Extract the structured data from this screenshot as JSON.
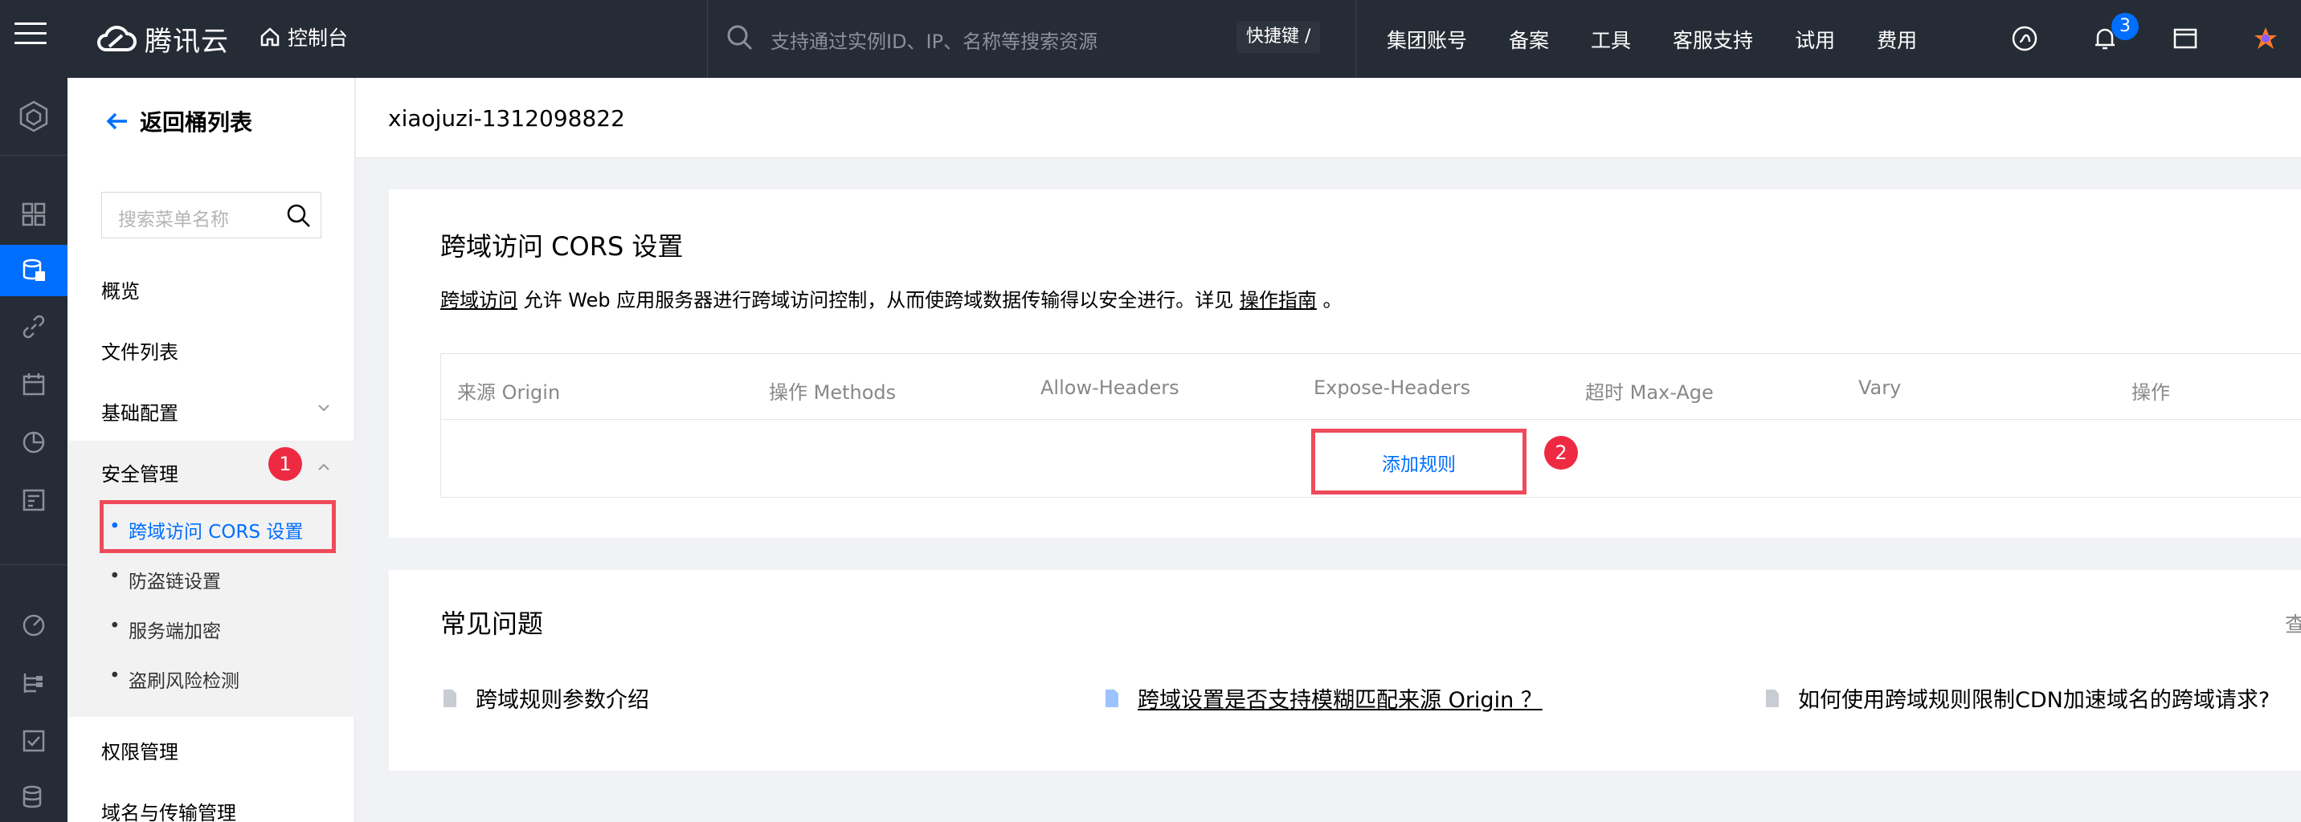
{
  "topbar": {
    "logo_text": "腾讯云",
    "console_label": "控制台",
    "search_placeholder": "支持通过实例ID、IP、名称等搜索资源",
    "shortcut_label": "快捷键 /",
    "nav": [
      "集团账号",
      "备案",
      "工具",
      "客服支持",
      "试用",
      "费用"
    ],
    "notification_count": "3"
  },
  "sidebar": {
    "back_label": "返回桶列表",
    "search_placeholder": "搜索菜单名称",
    "items": {
      "overview": "概览",
      "files": "文件列表",
      "basic_config": "基础配置",
      "security": "安全管理",
      "permissions": "权限管理",
      "domain": "域名与传输管理"
    },
    "security_sub": [
      "跨域访问 CORS 设置",
      "防盗链设置",
      "服务端加密",
      "盗刷风险检测"
    ],
    "step1": "1"
  },
  "main": {
    "bucket_name": "xiaojuzi-1312098822",
    "cors": {
      "title": "跨域访问 CORS 设置",
      "desc_link": "跨域访问",
      "desc_text": " 允许 Web 应用服务器进行跨域访问控制，从而使跨域数据传输得以安全进行。详见 ",
      "desc_guide": "操作指南",
      "desc_end": " 。",
      "columns": [
        "来源 Origin",
        "操作 Methods",
        "Allow-Headers",
        "Expose-Headers",
        "超时 Max-Age",
        "Vary",
        "操作"
      ],
      "add_rule": "添加规则",
      "step2": "2"
    },
    "faq": {
      "title": "常见问题",
      "more_glyph": "查",
      "items": [
        "跨域规则参数介绍",
        "跨域设置是否支持模糊匹配来源 Origin ？",
        "如何使用跨域规则限制CDN加速域名的跨域请求?"
      ]
    }
  },
  "colors": {
    "topbar_bg": "#262c36",
    "accent": "#006eff",
    "highlight_red": "#ee4b5a"
  }
}
